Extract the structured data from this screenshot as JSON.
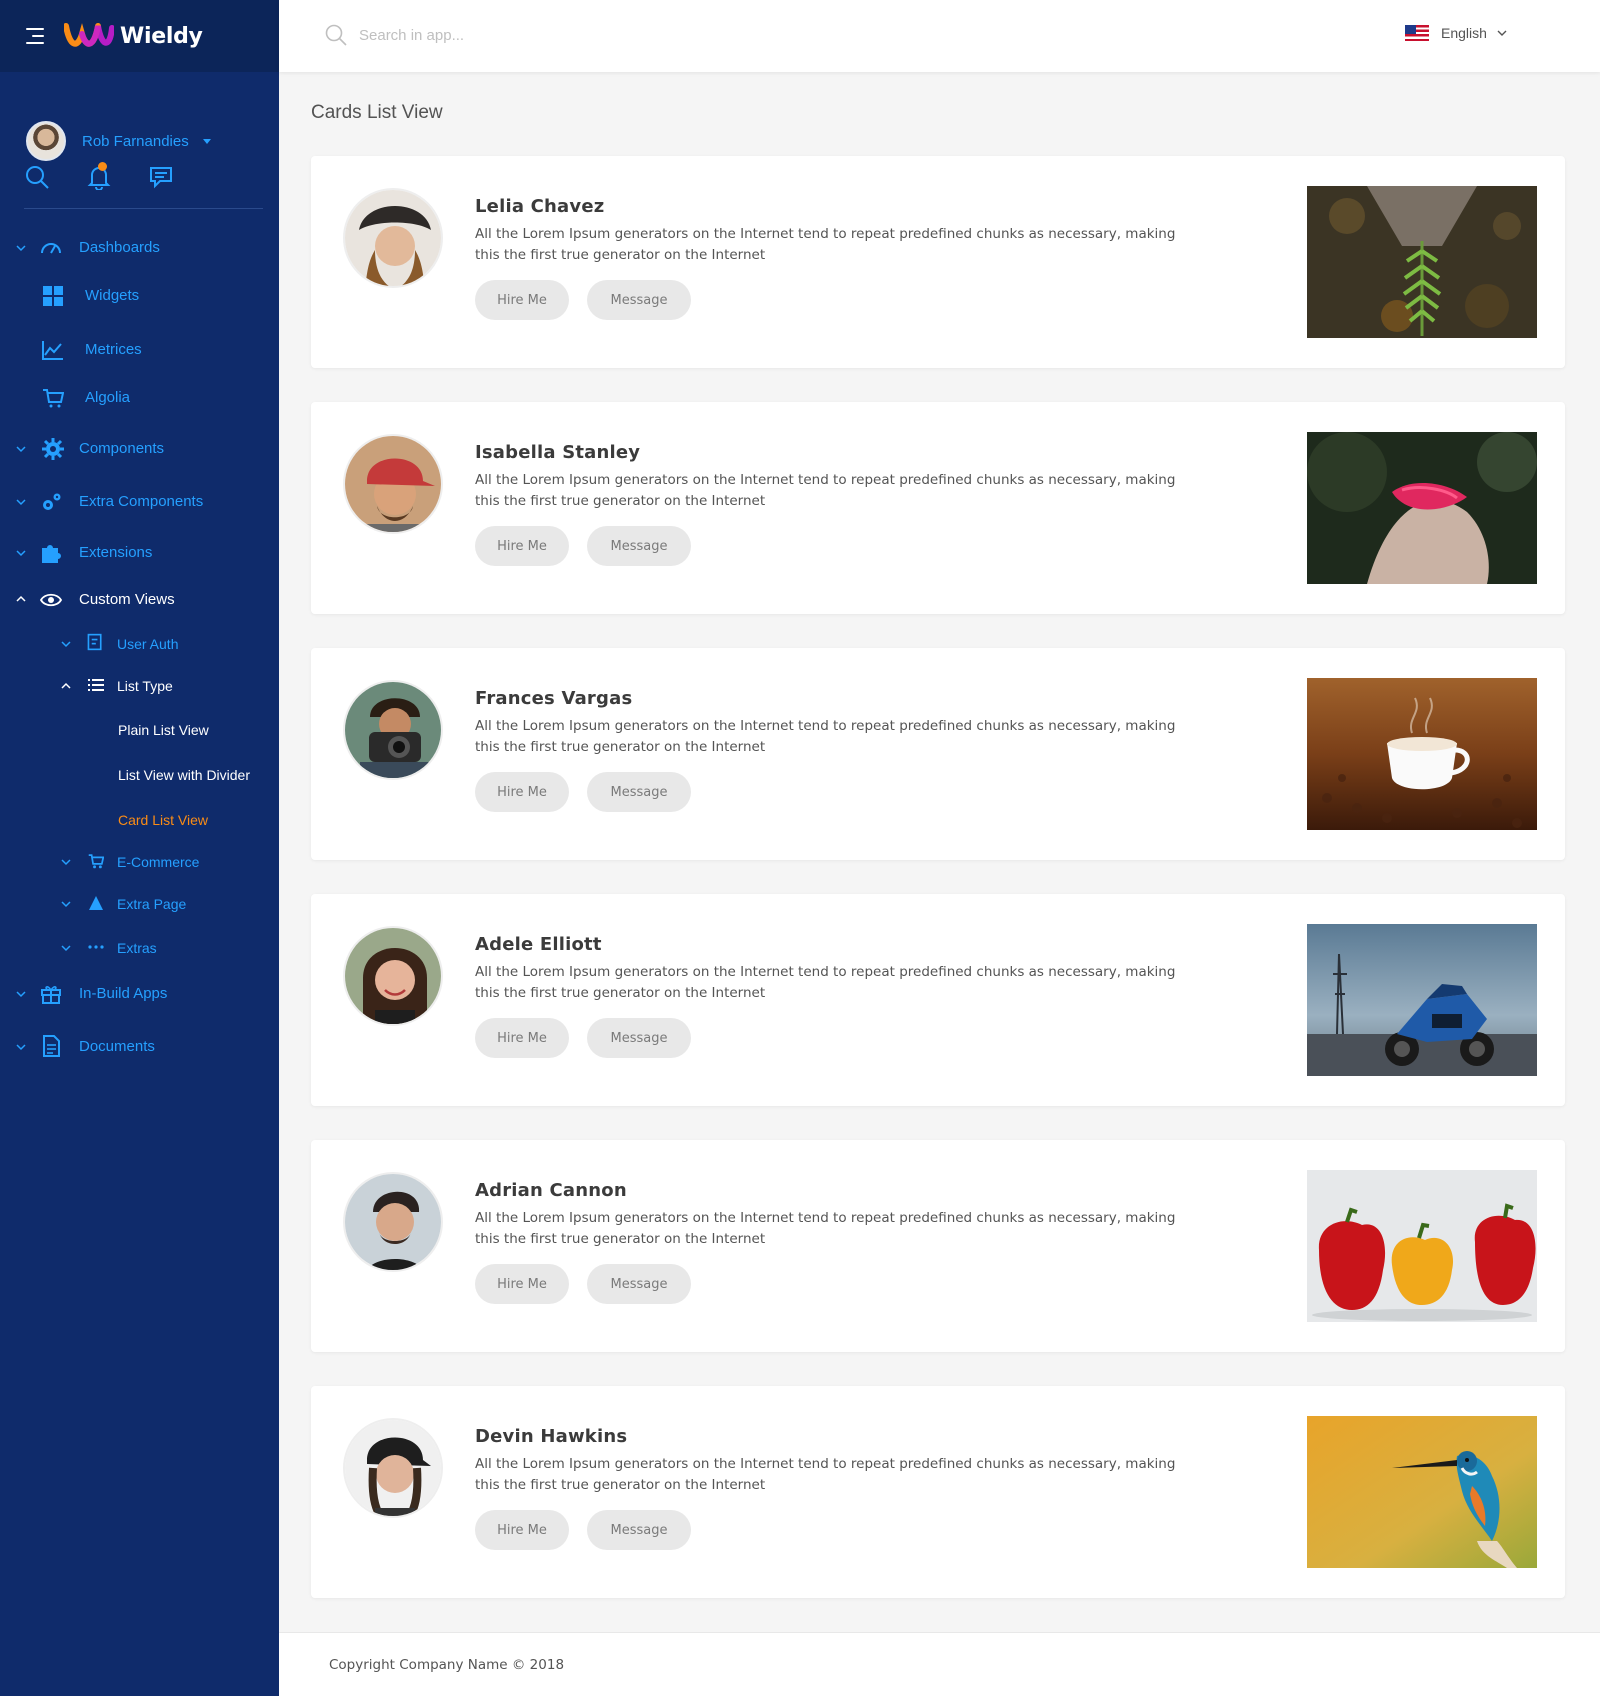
{
  "app": {
    "name": "Wieldy"
  },
  "user": {
    "name": "Rob Farnandies"
  },
  "search": {
    "placeholder": "Search in app..."
  },
  "language": {
    "label": "English"
  },
  "nav": {
    "dashboards": "Dashboards",
    "widgets": "Widgets",
    "metrices": "Metrices",
    "algolia": "Algolia",
    "components": "Components",
    "extra_components": "Extra Components",
    "extensions": "Extensions",
    "custom_views": "Custom Views",
    "user_auth": "User Auth",
    "list_type": "List Type",
    "plain_list_view": "Plain List View",
    "list_view_with_divider": "List View with Divider",
    "card_list_view": "Card List View",
    "ecommerce": "E-Commerce",
    "extra_page": "Extra Page",
    "extras": "Extras",
    "inbuild_apps": "In-Build Apps",
    "documents": "Documents"
  },
  "page": {
    "title": "Cards List View"
  },
  "buttons": {
    "hire": "Hire Me",
    "message": "Message"
  },
  "cards": [
    {
      "name": "Lelia Chavez",
      "description": "All the Lorem Ipsum generators on the Internet tend to repeat predefined chunks as necessary, making this the first true generator on the Internet"
    },
    {
      "name": "Isabella Stanley",
      "description": "All the Lorem Ipsum generators on the Internet tend to repeat predefined chunks as necessary, making this the first true generator on the Internet"
    },
    {
      "name": "Frances Vargas",
      "description": "All the Lorem Ipsum generators on the Internet tend to repeat predefined chunks as necessary, making this the first true generator on the Internet"
    },
    {
      "name": "Adele Elliott",
      "description": "All the Lorem Ipsum generators on the Internet tend to repeat predefined chunks as necessary, making this the first true generator on the Internet"
    },
    {
      "name": "Adrian Cannon",
      "description": "All the Lorem Ipsum generators on the Internet tend to repeat predefined chunks as necessary, making this the first true generator on the Internet"
    },
    {
      "name": "Devin Hawkins",
      "description": "All the Lorem Ipsum generators on the Internet tend to repeat predefined chunks as necessary, making this the first true generator on the Internet"
    }
  ],
  "footer": {
    "text": "Copyright Company Name © 2018"
  },
  "colors": {
    "sidebar_bg": "#0f2b6b",
    "accent_blue": "#25a0ff",
    "active_orange": "#fa8c16"
  }
}
